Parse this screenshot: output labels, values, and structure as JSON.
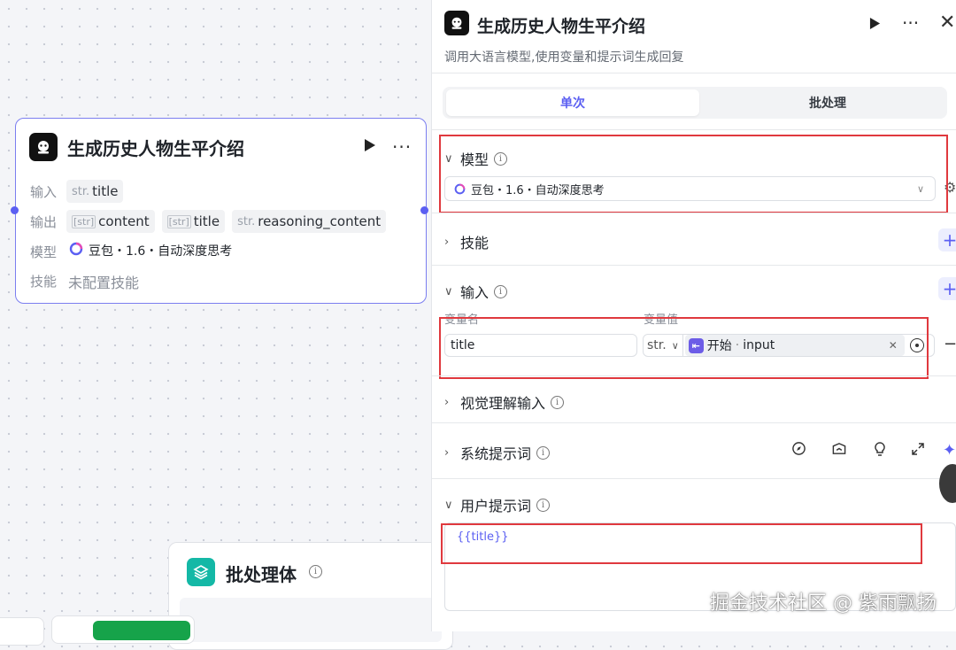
{
  "canvas_node": {
    "title": "生成历史人物生平介绍",
    "input_label": "输入",
    "output_label": "输出",
    "model_label": "模型",
    "skill_label": "技能",
    "inputs": [
      {
        "type": "str.",
        "name": "title"
      }
    ],
    "outputs": [
      {
        "type": "[str]",
        "name": "content"
      },
      {
        "type": "[str]",
        "name": "title"
      },
      {
        "type": "str.",
        "name": "reasoning_content"
      }
    ],
    "model_value": "豆包・1.6・自动深度思考",
    "skill_value": "未配置技能"
  },
  "batch_node": {
    "title": "批处理体"
  },
  "panel": {
    "title": "生成历史人物生平介绍",
    "description": "调用大语言模型,使用变量和提示词生成回复",
    "tabs": [
      {
        "label": "单次",
        "active": true
      },
      {
        "label": "批处理",
        "active": false
      }
    ],
    "sections": {
      "model": {
        "title": "模型",
        "value": "豆包・1.6・自动深度思考"
      },
      "skills": {
        "title": "技能"
      },
      "input": {
        "title": "输入",
        "col_name": "变量名",
        "col_value": "变量值",
        "var_name": "title",
        "var_type": "str.",
        "ref_source": "开始",
        "ref_field": "input"
      },
      "vision": {
        "title": "视觉理解输入"
      },
      "system_prompt": {
        "title": "系统提示词"
      },
      "user_prompt": {
        "title": "用户提示词",
        "content": "{{title}}"
      }
    }
  },
  "watermark": "掘金技术社区 @ 紫雨飘扬",
  "colors": {
    "accent": "#5b5ff2",
    "highlight_box": "#e0393e",
    "batch_icon": "#14b8a6"
  }
}
